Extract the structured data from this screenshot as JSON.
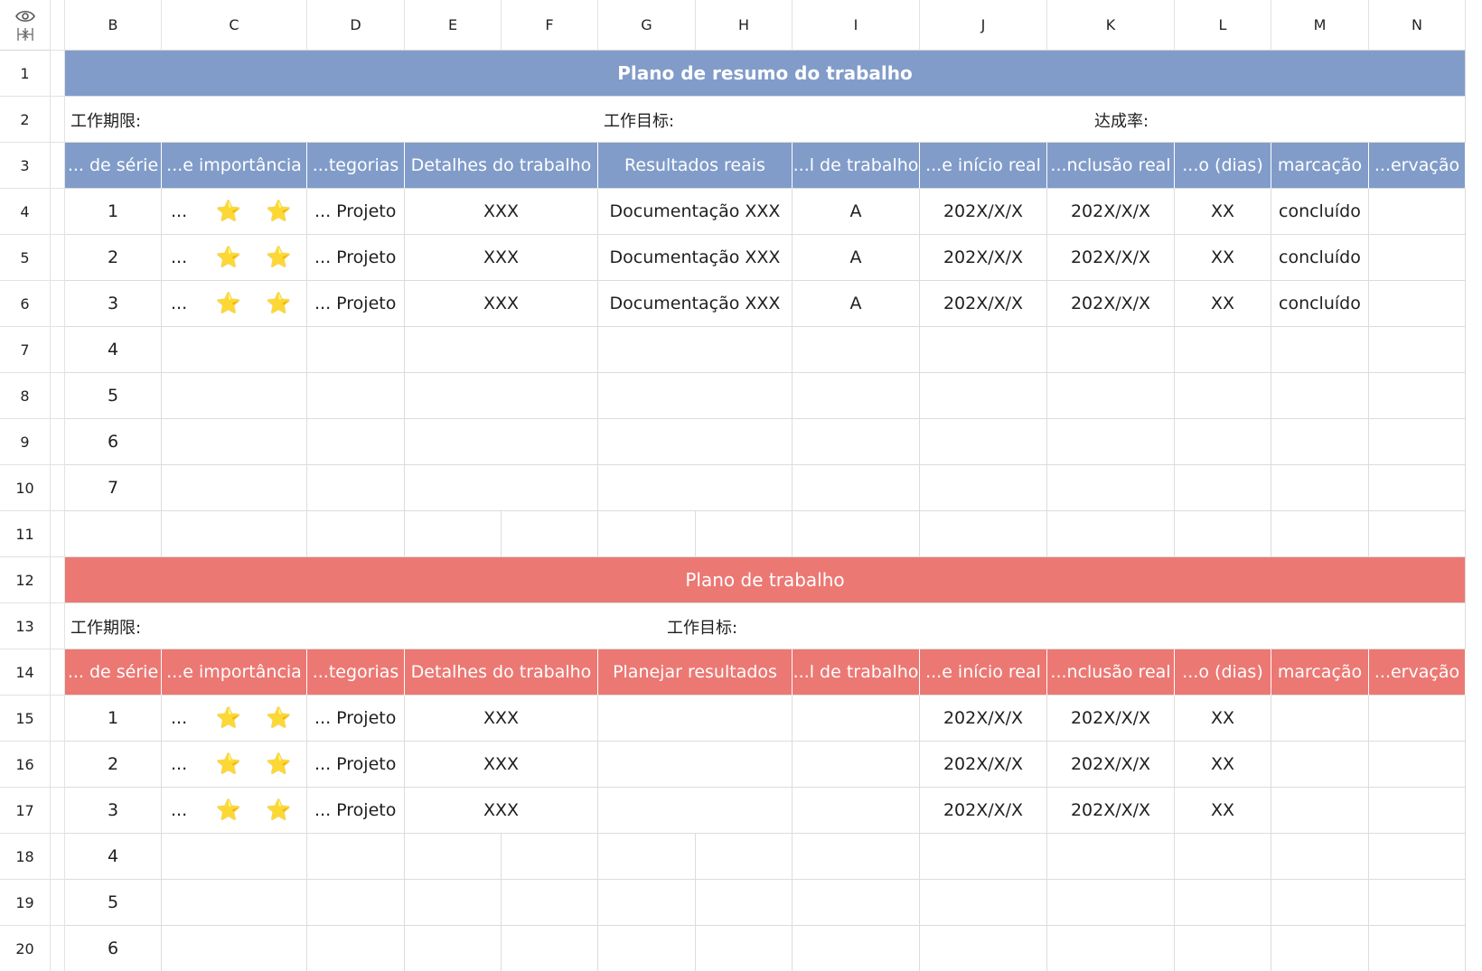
{
  "columns": [
    "B",
    "C",
    "D",
    "E",
    "F",
    "G",
    "H",
    "I",
    "J",
    "K",
    "L",
    "M",
    "N"
  ],
  "rows": [
    "1",
    "2",
    "3",
    "4",
    "5",
    "6",
    "7",
    "8",
    "9",
    "10",
    "11",
    "12",
    "13",
    "14",
    "15",
    "16",
    "17",
    "18",
    "19",
    "20"
  ],
  "corner_icons": [
    "eye-icon",
    "freeze-icon"
  ],
  "summary": {
    "title": "Plano de resumo do trabalho",
    "period_label": "工作期限:",
    "target_label": "工作目标:",
    "rate_label": "达成率:",
    "headers": [
      "... de série",
      "...e importância",
      "...tegorias",
      "Detalhes do trabalho",
      "Resultados reais",
      "...l de trabalho",
      "...e início real",
      "...nclusão real",
      "...o (dias)",
      "marcação",
      "...ervação"
    ],
    "rows": [
      {
        "serial": "1",
        "imp_dots": "...",
        "star": "⭐",
        "category": "... Projeto",
        "details": "XXX",
        "result": "Documentação XXX",
        "level": "A",
        "start": "202X/X/X",
        "end": "202X/X/X",
        "days": "XX",
        "mark": "concluído",
        "note": ""
      },
      {
        "serial": "2",
        "imp_dots": "...",
        "star": "⭐",
        "category": "... Projeto",
        "details": "XXX",
        "result": "Documentação XXX",
        "level": "A",
        "start": "202X/X/X",
        "end": "202X/X/X",
        "days": "XX",
        "mark": "concluído",
        "note": ""
      },
      {
        "serial": "3",
        "imp_dots": "...",
        "star": "⭐",
        "category": "... Projeto",
        "details": "XXX",
        "result": "Documentação XXX",
        "level": "A",
        "start": "202X/X/X",
        "end": "202X/X/X",
        "days": "XX",
        "mark": "concluído",
        "note": ""
      }
    ],
    "extra_serials": [
      "4",
      "5",
      "6",
      "7"
    ]
  },
  "plan": {
    "title": "Plano de trabalho",
    "period_label": "工作期限:",
    "target_label": "工作目标:",
    "headers": [
      "... de série",
      "...e importância",
      "...tegorias",
      "Detalhes do trabalho",
      "Planejar resultados",
      "...l de trabalho",
      "...e início real",
      "...nclusão real",
      "...o (dias)",
      "marcação",
      "...ervação"
    ],
    "rows": [
      {
        "serial": "1",
        "imp_dots": "...",
        "star": "⭐",
        "category": "... Projeto",
        "details": "XXX",
        "result": "",
        "level": "",
        "start": "202X/X/X",
        "end": "202X/X/X",
        "days": "XX",
        "mark": "",
        "note": ""
      },
      {
        "serial": "2",
        "imp_dots": "...",
        "star": "⭐",
        "category": "... Projeto",
        "details": "XXX",
        "result": "",
        "level": "",
        "start": "202X/X/X",
        "end": "202X/X/X",
        "days": "XX",
        "mark": "",
        "note": ""
      },
      {
        "serial": "3",
        "imp_dots": "...",
        "star": "⭐",
        "category": "... Projeto",
        "details": "XXX",
        "result": "",
        "level": "",
        "start": "202X/X/X",
        "end": "202X/X/X",
        "days": "XX",
        "mark": "",
        "note": ""
      }
    ],
    "extra_serials": [
      "4",
      "5",
      "6"
    ]
  },
  "colors": {
    "summary_accent": "#819cc9",
    "plan_accent": "#ec7873",
    "star": "#f5c518"
  }
}
